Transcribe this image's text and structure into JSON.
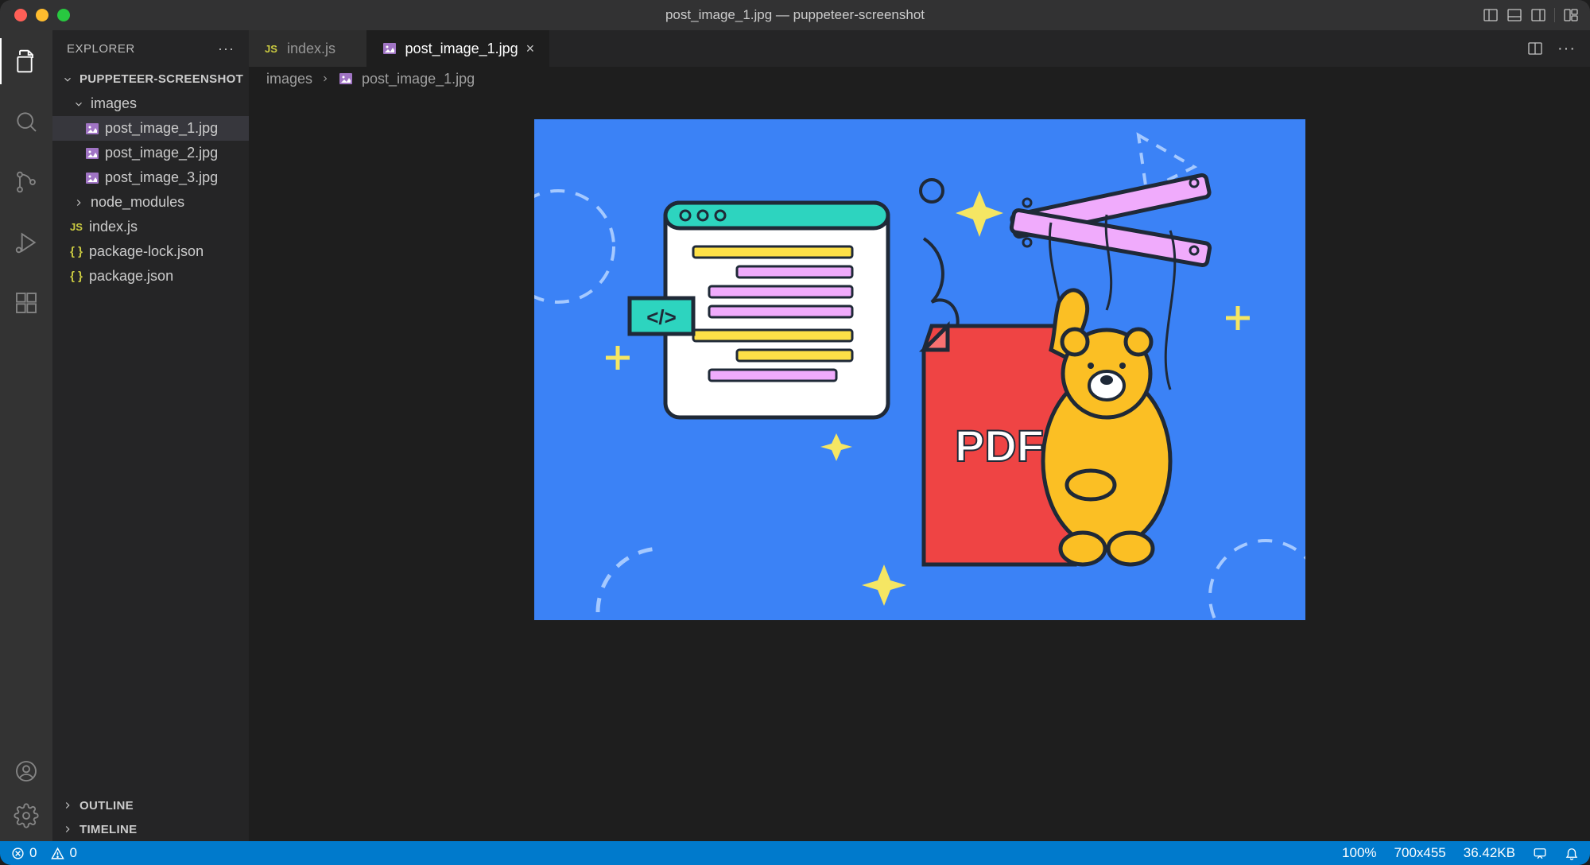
{
  "window_title": "post_image_1.jpg — puppeteer-screenshot",
  "sidebar": {
    "title": "EXPLORER",
    "root": "PUPPETEER-SCREENSHOT",
    "folders": {
      "images": {
        "label": "images",
        "files": [
          "post_image_1.jpg",
          "post_image_2.jpg",
          "post_image_3.jpg"
        ]
      },
      "node_modules": {
        "label": "node_modules"
      }
    },
    "root_files": {
      "index_js": "index.js",
      "pkg_lock": "package-lock.json",
      "pkg": "package.json"
    },
    "sections": {
      "outline": "OUTLINE",
      "timeline": "TIMELINE"
    }
  },
  "tabs": {
    "index": "index.js",
    "image": "post_image_1.jpg"
  },
  "breadcrumbs": {
    "part1": "images",
    "part2": "post_image_1.jpg"
  },
  "status": {
    "errors": "0",
    "warnings": "0",
    "zoom": "100%",
    "dimensions": "700x455",
    "size": "36.42KB"
  },
  "image_art": {
    "pdf_text": "PDF",
    "code_tag": "</>"
  }
}
